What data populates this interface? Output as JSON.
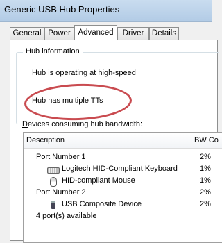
{
  "window": {
    "title": "Generic USB Hub Properties"
  },
  "tabs": [
    {
      "label": "General"
    },
    {
      "label": "Power"
    },
    {
      "label": "Advanced",
      "active": true
    },
    {
      "label": "Driver"
    },
    {
      "label": "Details"
    }
  ],
  "hub_info": {
    "group_label": "Hub information",
    "line1": "Hub is operating at high-speed",
    "line2": "Hub has multiple TTs"
  },
  "devices": {
    "label_prefix": "D",
    "label_rest": "evices consuming hub bandwidth:",
    "columns": {
      "description": "Description",
      "bw": "BW Co"
    },
    "rows": [
      {
        "text": "Port Number 1",
        "bw": "2%",
        "icon": ""
      },
      {
        "text": "Logitech HID-Compliant Keyboard",
        "bw": "1%",
        "icon": "keyboard-icon"
      },
      {
        "text": "HID-compliant Mouse",
        "bw": "1%",
        "icon": "mouse-icon"
      },
      {
        "text": "Port Number 2",
        "bw": "2%",
        "icon": ""
      },
      {
        "text": "USB Composite Device",
        "bw": "2%",
        "icon": "usb-icon"
      },
      {
        "text": "4 port(s) available",
        "bw": "",
        "icon": ""
      }
    ]
  },
  "colors": {
    "highlight_ellipse": "#c94b50",
    "title_bar": "#c9dcef"
  }
}
